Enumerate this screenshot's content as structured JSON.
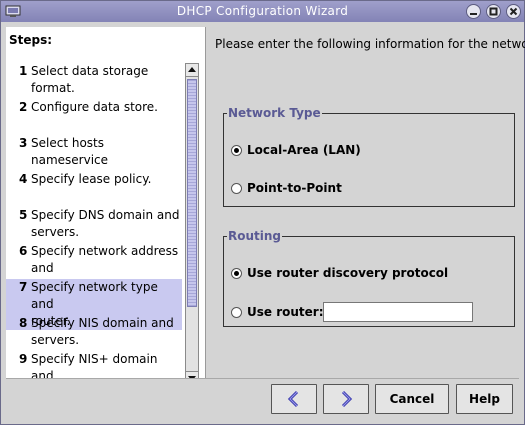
{
  "window": {
    "title": "DHCP Configuration Wizard"
  },
  "steps": {
    "title": "Steps:",
    "items": [
      {
        "num": "1",
        "label": "Select data storage format."
      },
      {
        "num": "2",
        "label": "Configure data store."
      },
      {
        "num": "3",
        "label": "Select hosts nameservice"
      },
      {
        "num": "4",
        "label": "Specify lease policy."
      },
      {
        "num": "5",
        "label": "Specify DNS domain and\nservers."
      },
      {
        "num": "6",
        "label": "Specify network address and\nsubnet mask."
      },
      {
        "num": "7",
        "label": "Specify network type and\nrouter."
      },
      {
        "num": "8",
        "label": "Specify NIS domain and\nservers."
      },
      {
        "num": "9",
        "label": "Specify NIS+ domain and"
      }
    ],
    "active_index": 6
  },
  "main": {
    "instruction": "Please enter the following information for the network:",
    "network_type": {
      "legend": "Network Type",
      "options": [
        {
          "label": "Local-Area (LAN)",
          "checked": true
        },
        {
          "label": "Point-to-Point",
          "checked": false
        }
      ]
    },
    "routing": {
      "legend": "Routing",
      "options": [
        {
          "label": "Use router discovery protocol",
          "checked": true
        },
        {
          "label": "Use router:",
          "checked": false
        }
      ],
      "router_value": ""
    }
  },
  "buttons": {
    "back_label": "",
    "next_label": "",
    "cancel_label": "Cancel",
    "help_label": "Help"
  },
  "colors": {
    "titlebar": "#8f8fc0",
    "legend": "#5a5a94",
    "selection": "#c9c9f0"
  }
}
